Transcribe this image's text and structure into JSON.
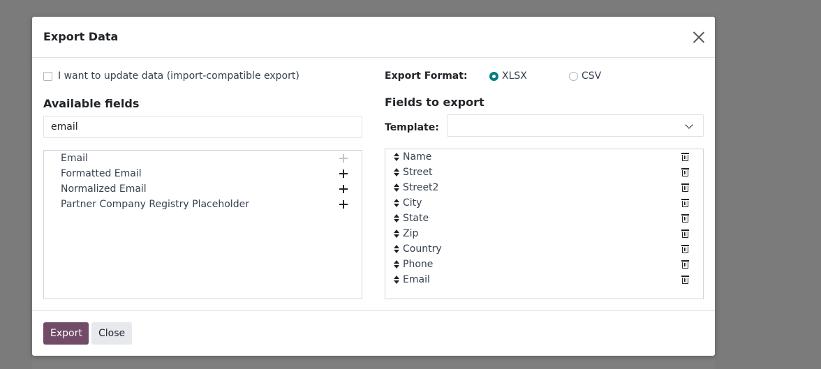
{
  "dialog": {
    "title": "Export Data",
    "close_label": "×"
  },
  "left": {
    "import_compatible_label": "I want to update data (import-compatible export)",
    "available_title": "Available fields",
    "search_value": "email",
    "available_fields": [
      {
        "label": "Email",
        "added": true
      },
      {
        "label": "Formatted Email",
        "added": false
      },
      {
        "label": "Normalized Email",
        "added": false
      },
      {
        "label": "Partner Company Registry Placeholder",
        "added": false
      }
    ]
  },
  "right": {
    "format_label": "Export Format:",
    "formats": [
      {
        "label": "XLSX",
        "selected": true
      },
      {
        "label": "CSV",
        "selected": false
      }
    ],
    "fields_title": "Fields to export",
    "template_label": "Template:",
    "template_value": "",
    "export_fields": [
      "Name",
      "Street",
      "Street2",
      "City",
      "State",
      "Zip",
      "Country",
      "Phone",
      "Email"
    ]
  },
  "footer": {
    "export_label": "Export",
    "close_label": "Close"
  },
  "colors": {
    "primary": "#714b67",
    "radio_accent": "#017e84",
    "backdrop": "#7b7b7b"
  }
}
